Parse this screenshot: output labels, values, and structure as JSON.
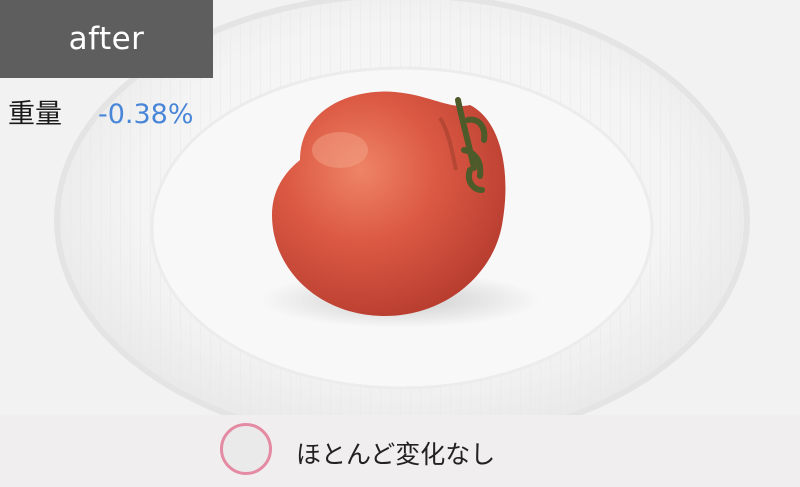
{
  "tag": "after",
  "metric": {
    "label": "重量",
    "value": "-0.38%"
  },
  "result": {
    "icon": "circle-mark-icon",
    "text": "ほとんど変化なし"
  },
  "colors": {
    "tag_bg": "#5e5e5e",
    "value": "#4a86d8",
    "circle": "#e48aa3"
  }
}
